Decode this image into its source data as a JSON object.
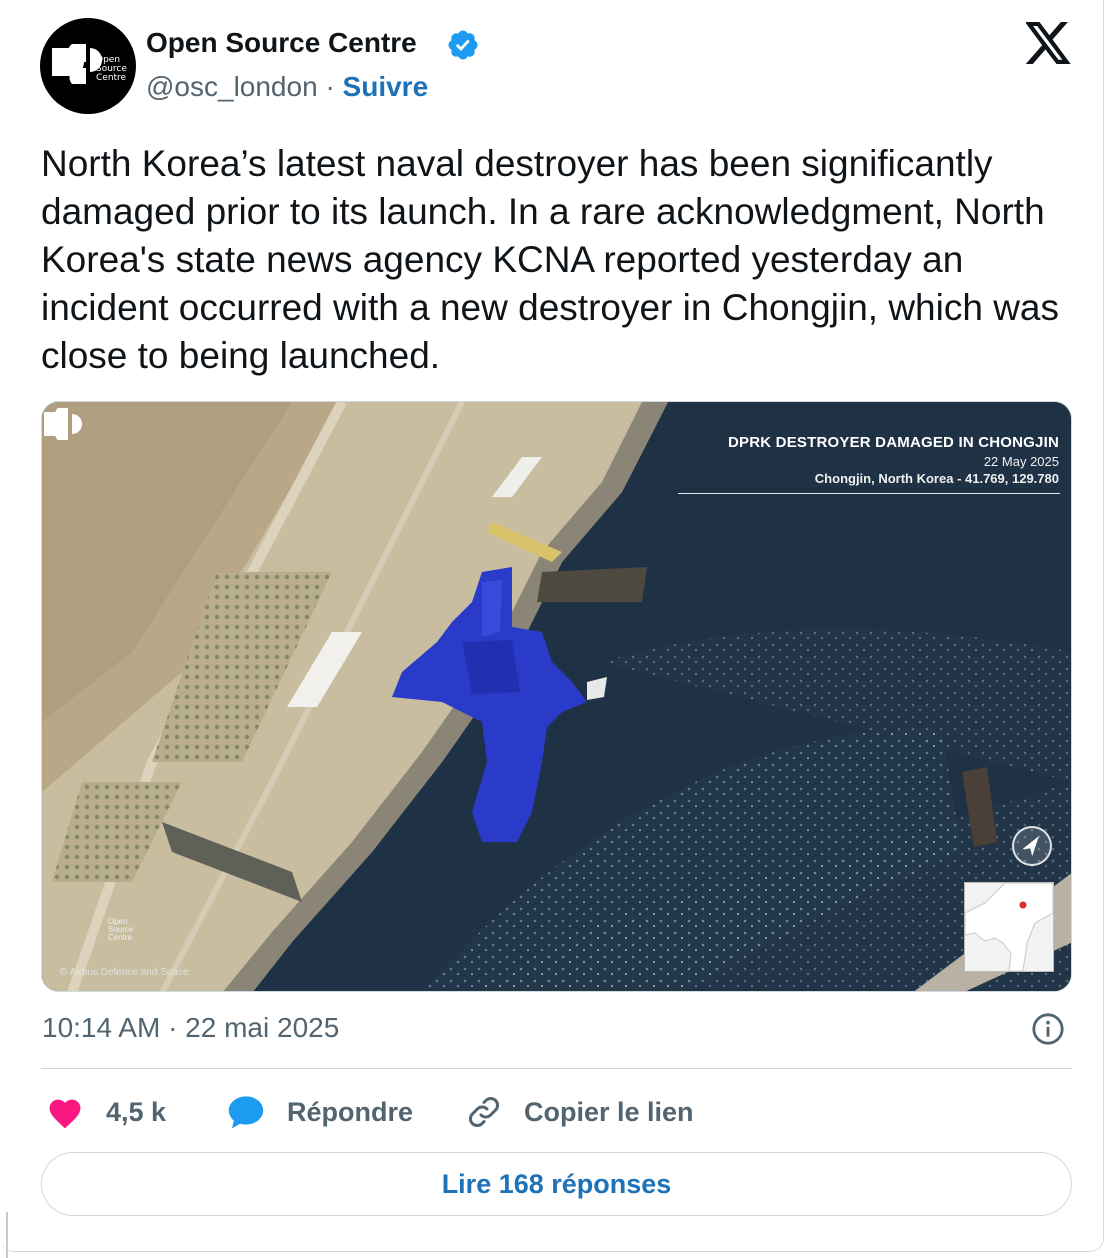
{
  "author": {
    "name": "Open Source Centre",
    "handle": "@osc_london",
    "separator": "·",
    "follow_label": "Suivre",
    "avatar_text": "Open\nSource\nCentre",
    "verified_icon": "verified-badge-icon"
  },
  "tweet": {
    "text": "North Korea’s latest naval destroyer has been significantly damaged prior to its launch. In a rare acknowledgment, North Korea's state news agency KCNA reported yesterday an incident occurred with a new destroyer in Chongjin, which was close to being launched."
  },
  "media": {
    "title": "DPRK DESTROYER DAMAGED IN CHONGJIN",
    "date": "22 May 2025",
    "location": "Chongjin, North Korea - 41.769, 129.780",
    "watermark_text": "Open\nSource\nCentre",
    "credit": "© Airbus Defence and Space"
  },
  "meta": {
    "timestamp": "10:14 AM · 22 mai 2025"
  },
  "actions": {
    "like_count": "4,5 k",
    "reply_label": "Répondre",
    "copy_label": "Copier le lien"
  },
  "read_replies_label": "Lire 168 réponses",
  "colors": {
    "link_blue": "#1d72b8",
    "verified_blue": "#1d9bf0",
    "heart_pink": "#f91880",
    "muted_text": "#536471"
  }
}
